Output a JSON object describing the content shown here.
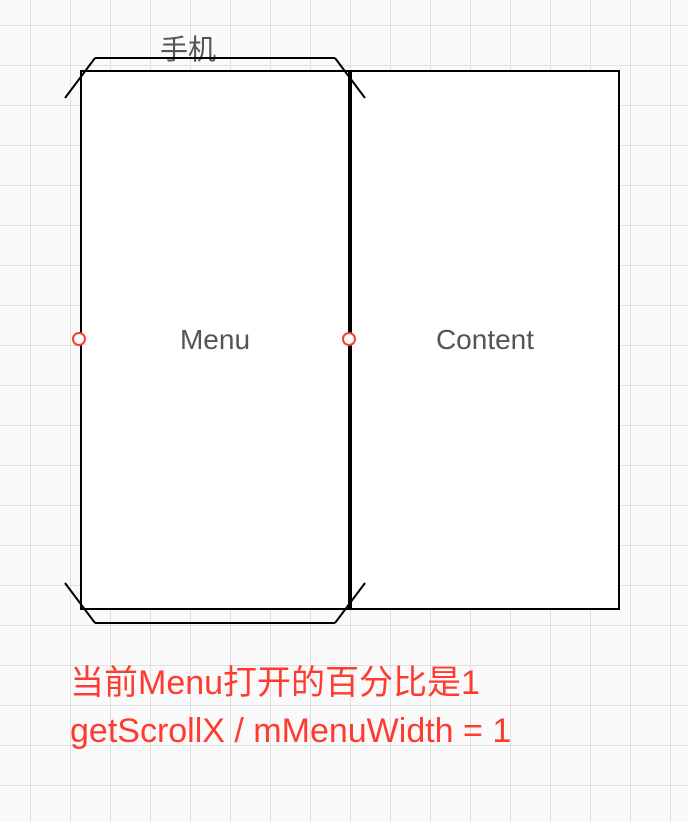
{
  "labels": {
    "phone": "手机",
    "menu": "Menu",
    "content": "Content"
  },
  "caption": {
    "line1": "当前Menu打开的百分比是1",
    "line2": "getScrollX / mMenuWidth = 1"
  },
  "colors": {
    "accent": "#ff3b30",
    "border": "#000000",
    "grid": "#e0e0e0",
    "text": "#555555"
  }
}
